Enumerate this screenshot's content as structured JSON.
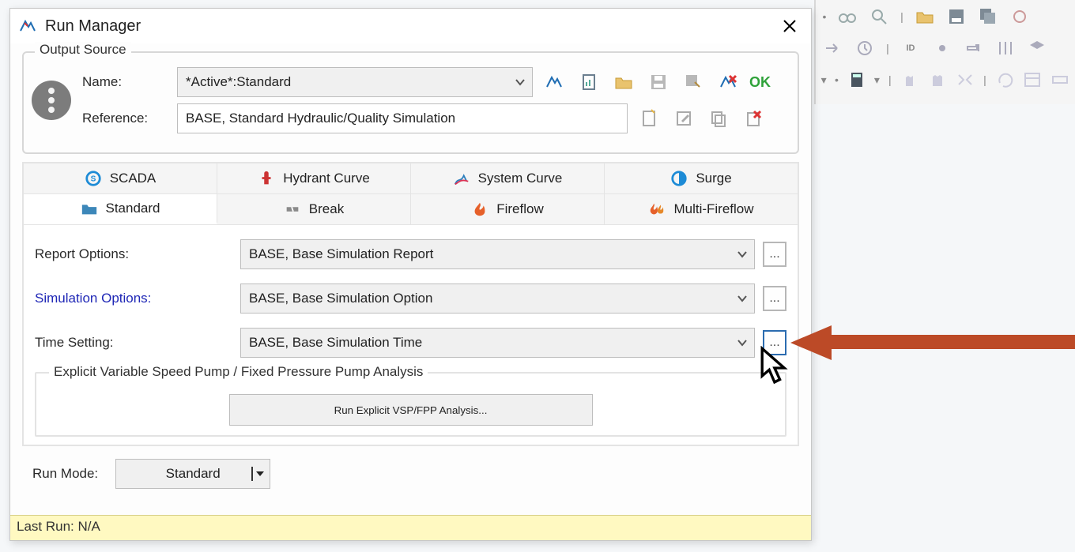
{
  "title": "Run Manager",
  "output_source": {
    "legend": "Output Source",
    "name_label": "Name:",
    "name_value": "*Active*:Standard",
    "reference_label": "Reference:",
    "reference_value": "BASE, Standard Hydraulic/Quality Simulation",
    "ok": "OK"
  },
  "tabs_row1": [
    {
      "id": "scada",
      "label": "SCADA"
    },
    {
      "id": "hydrant",
      "label": "Hydrant Curve"
    },
    {
      "id": "syscurve",
      "label": "System Curve"
    },
    {
      "id": "surge",
      "label": "Surge"
    }
  ],
  "tabs_row2": [
    {
      "id": "standard",
      "label": "Standard",
      "active": true
    },
    {
      "id": "break",
      "label": "Break"
    },
    {
      "id": "fireflow",
      "label": "Fireflow"
    },
    {
      "id": "multifire",
      "label": "Multi-Fireflow"
    }
  ],
  "standard_tab": {
    "report_label": "Report Options:",
    "report_value": "BASE, Base Simulation Report",
    "sim_label": "Simulation Options:",
    "sim_value": "BASE, Base Simulation Option",
    "time_label": "Time Setting:",
    "time_value": "BASE, Base Simulation Time",
    "vsp_group": "Explicit Variable Speed Pump / Fixed Pressure Pump Analysis",
    "vsp_button": "Run Explicit VSP/FPP Analysis..."
  },
  "run_mode": {
    "label": "Run Mode:",
    "value": "Standard"
  },
  "status": "Last Run: N/A",
  "icons": {
    "run": "run-icon",
    "report": "report-icon",
    "open": "folder-open-icon",
    "save": "save-icon",
    "saveas": "save-as-icon",
    "runfail": "run-fail-icon",
    "browse_new": "new-icon",
    "browse_edit": "edit-icon",
    "browse_copy": "copy-icon",
    "browse_del": "delete-icon"
  }
}
